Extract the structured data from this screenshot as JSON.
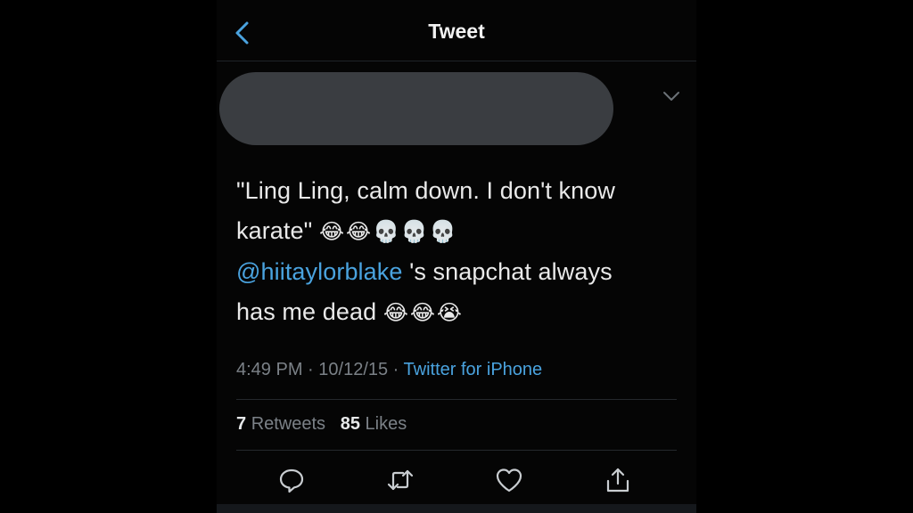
{
  "nav": {
    "title": "Tweet",
    "back_icon": "chevron-left-icon"
  },
  "author": {
    "redacted": true,
    "menu_icon": "chevron-down-icon"
  },
  "tweet": {
    "line1": "\"Ling Ling, calm down. I don't know",
    "line2_text": "karate\"",
    "line2_emoji": "😂😂💀💀💀",
    "mention": "@hiitaylorblake",
    "line3_rest": " 's snapchat always",
    "line4_text": "has me dead",
    "line4_emoji": "😂😂😭"
  },
  "meta": {
    "time": "4:49 PM",
    "sep1": " · ",
    "date": "10/12/15",
    "sep2": " · ",
    "source": "Twitter for iPhone"
  },
  "stats": {
    "retweets_count": "7",
    "retweets_label": "Retweets",
    "likes_count": "85",
    "likes_label": "Likes"
  },
  "actions": {
    "reply_icon": "reply-icon",
    "retweet_icon": "retweet-icon",
    "like_icon": "heart-icon",
    "share_icon": "share-icon"
  },
  "colors": {
    "background": "#000000",
    "text": "#e9e9e9",
    "muted": "#7b8187",
    "link": "#4aa3df",
    "redaction": "#3a3d41"
  }
}
